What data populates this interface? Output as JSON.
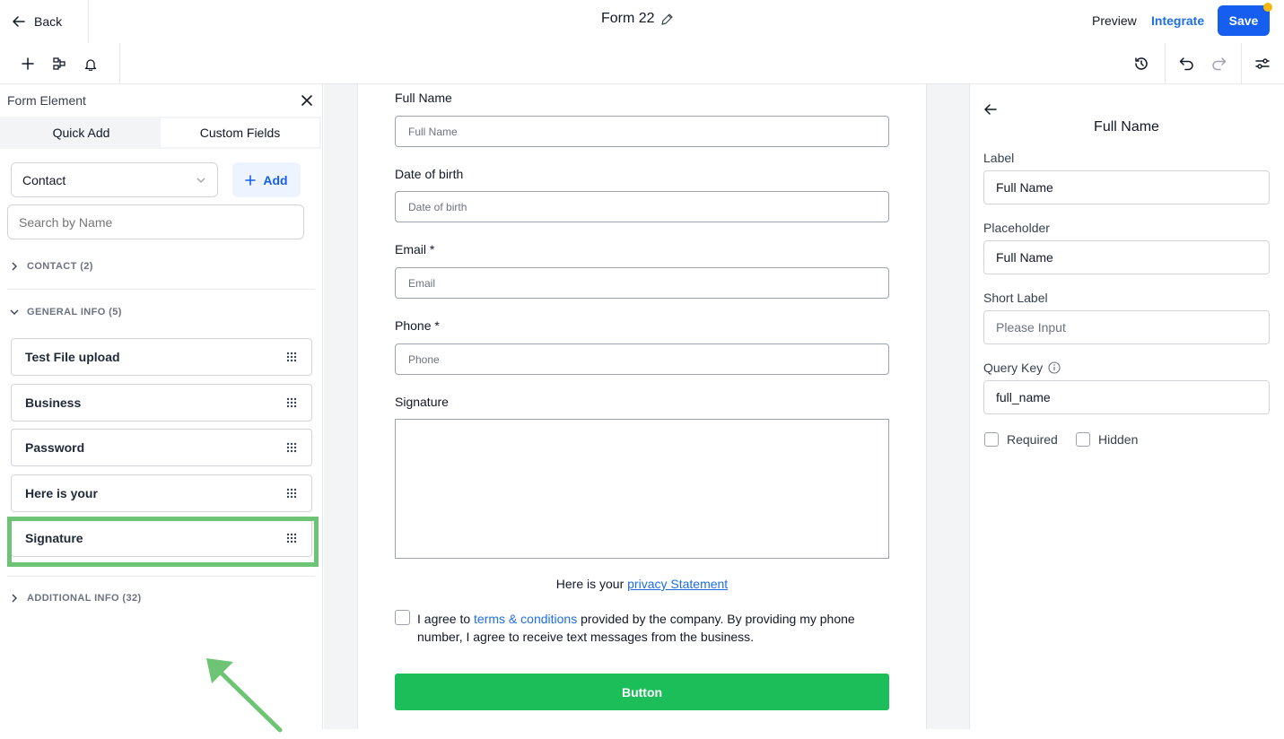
{
  "header": {
    "back_label": "Back",
    "form_title": "Form 22",
    "preview_label": "Preview",
    "integrate_label": "Integrate",
    "save_label": "Save"
  },
  "toolbar": {
    "left_icons": [
      "plus-icon",
      "layout-icon",
      "bell-icon"
    ],
    "right_icons": [
      "history-icon",
      "undo-icon",
      "redo-icon",
      "settings-sliders-icon"
    ]
  },
  "left_panel": {
    "title": "Form Element",
    "tabs": [
      {
        "label": "Quick Add"
      },
      {
        "label": "Custom Fields",
        "active": true
      }
    ],
    "object_select": "Contact",
    "add_label": "Add",
    "search_placeholder": "Search by Name",
    "sections": [
      {
        "label": "CONTACT (2)",
        "expanded": false
      },
      {
        "label": "GENERAL INFO (5)",
        "expanded": true
      },
      {
        "label": "ADDITIONAL INFO (32)",
        "expanded": false
      }
    ],
    "general_info_fields": [
      "Test File upload",
      "Business",
      "Password",
      "Here is your",
      "Signature"
    ]
  },
  "form": {
    "fields": [
      {
        "label": "Full Name",
        "placeholder": "Full Name"
      },
      {
        "label": "Date of birth",
        "placeholder": "Date of birth"
      },
      {
        "label": "Email *",
        "placeholder": "Email"
      },
      {
        "label": "Phone *",
        "placeholder": "Phone"
      }
    ],
    "signature_label": "Signature",
    "privacy_prefix": "Here is your ",
    "privacy_link": "privacy Statement",
    "agree_prefix": "I agree to ",
    "agree_link": "terms & conditions",
    "agree_suffix": " provided by the company. By providing my phone number, I agree to receive text messages from the business.",
    "button_label": "Button"
  },
  "right_panel": {
    "title": "Full Name",
    "label_title": "Label",
    "label_value": "Full Name",
    "placeholder_title": "Placeholder",
    "placeholder_value": "Full Name",
    "short_label_title": "Short Label",
    "short_label_placeholder": "Please Input",
    "query_key_title": "Query Key",
    "query_key_value": "full_name",
    "required_label": "Required",
    "hidden_label": "Hidden"
  },
  "colors": {
    "primary": "#155eef",
    "link": "#1d6ee8",
    "submit_green": "#1cbe5a",
    "highlight_green": "#6cc474",
    "notification_dot": "#f5b90b"
  }
}
